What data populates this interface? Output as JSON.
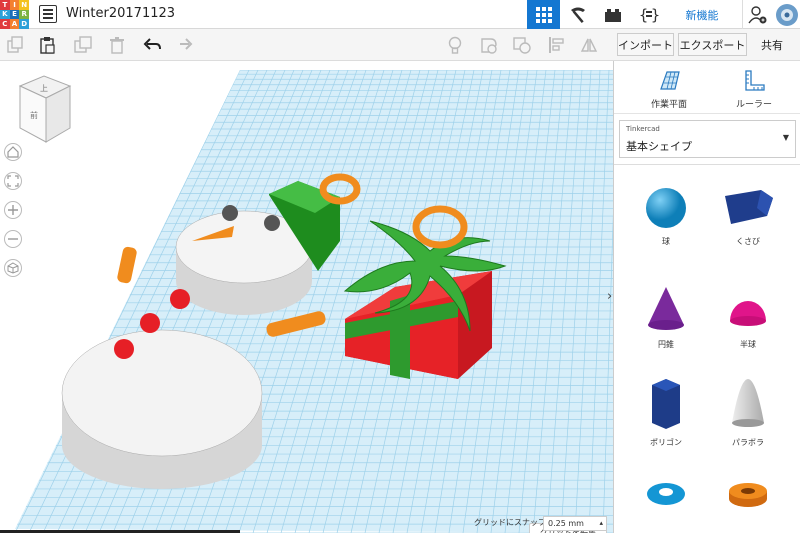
{
  "logo": {
    "letters": [
      "T",
      "I",
      "N",
      "K",
      "E",
      "R",
      "C",
      "A",
      "D"
    ],
    "colors": [
      "#e03a3e",
      "#f4802f",
      "#f4c21f",
      "#2aa0d8",
      "#1d6eb8",
      "#7cb242",
      "#e03a3e",
      "#f4802f",
      "#2aa0d8"
    ]
  },
  "header": {
    "title": "Winter20171123",
    "new_feature": "新機能"
  },
  "toolbar": {
    "import": "インポート",
    "export": "エクスポート",
    "share": "共有"
  },
  "panel": {
    "workplane": "作業平面",
    "ruler": "ルーラー",
    "library_source": "Tinkercad",
    "library_name": "基本シェイプ",
    "shapes": [
      {
        "label": "球",
        "icon": "sphere-icon"
      },
      {
        "label": "くさび",
        "icon": "wedge-icon"
      },
      {
        "label": "円錐",
        "icon": "cone-icon"
      },
      {
        "label": "半球",
        "icon": "half-sphere-icon"
      },
      {
        "label": "ポリゴン",
        "icon": "polygon-icon"
      },
      {
        "label": "パラボラ",
        "icon": "paraboloid-icon"
      },
      {
        "label": "",
        "icon": "torus-icon"
      },
      {
        "label": "",
        "icon": "tube-icon"
      }
    ]
  },
  "viewport": {
    "viewcube_top": "上",
    "viewcube_front": "前",
    "edit_grid": "グリッドを編集",
    "snap_grid_label": "グリッドにスナップ",
    "snap_grid_value": "0.25 mm"
  },
  "colors": {
    "accent": "#1477d1",
    "grid": "#a9dcf0",
    "box": "#e62227",
    "ribbon": "#3aae3a",
    "handle": "#f08c1e",
    "snowman": "#f2f2f2"
  }
}
